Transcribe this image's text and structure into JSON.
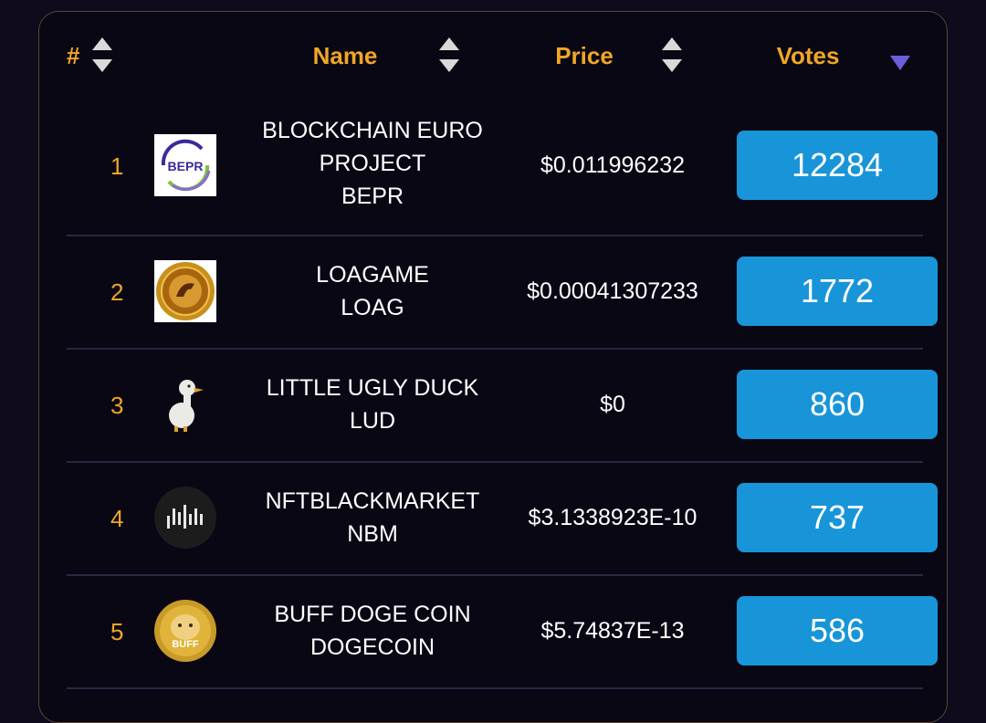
{
  "table": {
    "headers": {
      "rank": "#",
      "name": "Name",
      "price": "Price",
      "votes": "Votes"
    },
    "sort_state": {
      "votes": "descending"
    },
    "colors": {
      "accent": "#f0a626",
      "vote_button": "#1895d8",
      "sort_active": "#6a5fd8"
    },
    "rows": [
      {
        "rank": "1",
        "name_line1": "BLOCKCHAIN EURO",
        "name_line2": "PROJECT",
        "symbol": "BEPR",
        "price": "$0.011996232",
        "votes": "12284",
        "logo_text": "BEPR",
        "logo_icon": "bepr-logo-icon"
      },
      {
        "rank": "2",
        "name_line1": "LOAGAME",
        "name_line2": "",
        "symbol": "LOAG",
        "price": "$0.00041307233",
        "votes": "1772",
        "logo_text": "",
        "logo_icon": "loagame-logo-icon"
      },
      {
        "rank": "3",
        "name_line1": "LITTLE UGLY DUCK",
        "name_line2": "",
        "symbol": "LUD",
        "price": "$0",
        "votes": "860",
        "logo_text": "",
        "logo_icon": "duck-logo-icon"
      },
      {
        "rank": "4",
        "name_line1": "NFTBLACKMARKET",
        "name_line2": "",
        "symbol": "NBM",
        "price": "$3.1338923E-10",
        "votes": "737",
        "logo_text": "",
        "logo_icon": "nbm-logo-icon"
      },
      {
        "rank": "5",
        "name_line1": "BUFF DOGE COIN",
        "name_line2": "",
        "symbol": "DOGECOIN",
        "price": "$5.74837E-13",
        "votes": "586",
        "logo_text": "BUFF",
        "logo_icon": "buffdoge-logo-icon"
      }
    ]
  }
}
